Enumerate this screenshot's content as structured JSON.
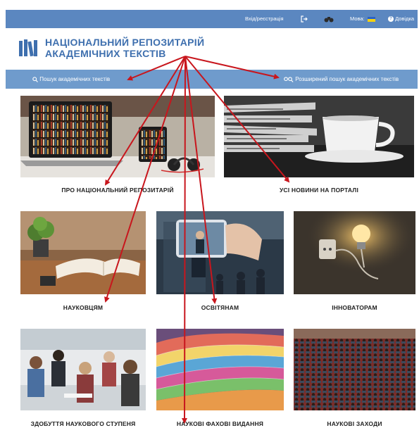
{
  "topbar": {
    "login_label": "Вхід/реєстрація",
    "language_label": "Мова:",
    "help_label": "Довідка",
    "logout_icon": "logout-icon",
    "binoculars_icon": "binoculars-icon",
    "help_icon": "help-circle-icon",
    "flag_colors": [
      "#2a62c9",
      "#f5d10f"
    ]
  },
  "logo": {
    "line1": "НАЦІОНАЛЬНИЙ РЕПОЗИТАРІЙ",
    "line2": "АКАДЕМІЧНИХ ТЕКСТІВ",
    "brand_color": "#3e6fae"
  },
  "search": {
    "basic_label": "Пошук академічних текстів",
    "advanced_label": "Розширений пошук академічних текстів"
  },
  "tiles": [
    {
      "caption": "ПРО НАЦІОНАЛЬНИЙ РЕПОЗИТАРІЙ",
      "image": "laptop-library-photo"
    },
    {
      "caption": "УСІ НОВИНИ НА ПОРТАЛІ",
      "image": "newspapers-coffee-photo"
    },
    {
      "caption": "НАУКОВЦЯМ",
      "image": "open-book-photo"
    },
    {
      "caption": "ОСВІТЯНАМ",
      "image": "conference-phone-photo"
    },
    {
      "caption": "ІННОВАТОРАМ",
      "image": "lightbulb-photo"
    },
    {
      "caption": "ЗДОБУТТЯ НАУКОВОГО СТУПЕНЯ",
      "image": "students-photo"
    },
    {
      "caption": "НАУКОВІ ФАХОВІ ВИДАННЯ",
      "image": "journals-photo"
    },
    {
      "caption": "НАУКОВІ ЗАХОДИ",
      "image": "auditorium-photo"
    }
  ],
  "annotation": {
    "arrow_color": "#c8161d"
  }
}
